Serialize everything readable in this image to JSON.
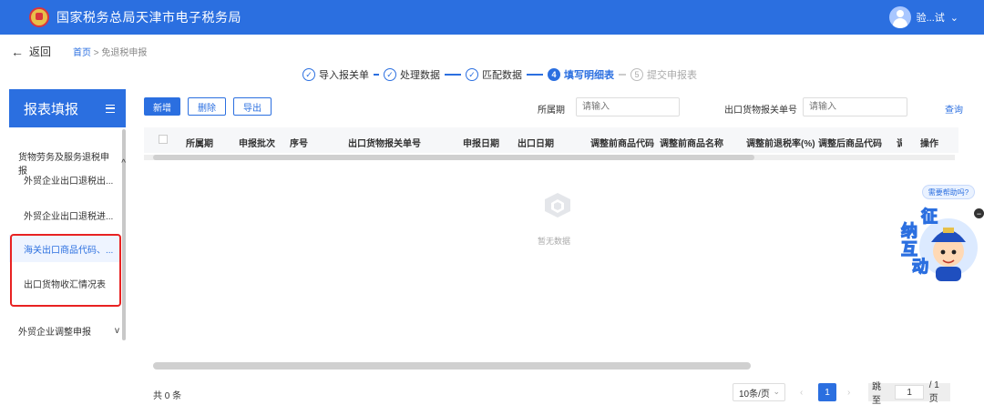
{
  "header": {
    "title": "国家税务总局天津市电子税务局",
    "user_name": "验...试"
  },
  "nav": {
    "back_label": "返回",
    "breadcrumb_home": "首页",
    "breadcrumb_sep": ">",
    "breadcrumb_current": "免退税申报"
  },
  "steps": [
    {
      "label": "导入报关单",
      "marker": "✓"
    },
    {
      "label": "处理数据",
      "marker": "✓"
    },
    {
      "label": "匹配数据",
      "marker": "✓"
    },
    {
      "label": "填写明细表",
      "marker": "4"
    },
    {
      "label": "提交申报表",
      "marker": "5"
    }
  ],
  "sidebar": {
    "title": "报表填报",
    "group1": "货物劳务及服务退税申报",
    "group1_arrow": "^",
    "items": [
      "外贸企业出口退税出...",
      "外贸企业出口退税进...",
      "海关出口商品代码、...",
      "出口货物收汇情况表"
    ],
    "group2": "外贸企业调整申报",
    "group2_arrow": "v"
  },
  "toolbar": {
    "add": "新增",
    "delete": "删除",
    "export": "导出"
  },
  "filters": {
    "period_label": "所属期",
    "period_placeholder": "请输入",
    "customs_label": "出口货物报关单号",
    "customs_placeholder": "请输入",
    "query": "查询"
  },
  "table": {
    "columns": [
      "所属期",
      "申报批次",
      "序号",
      "出口货物报关单号",
      "申报日期",
      "出口日期",
      "调整前商品代码",
      "调整前商品名称",
      "调整前退税率(%)",
      "调整后商品代码",
      "调",
      "操作"
    ],
    "empty_text": "暂无数据"
  },
  "pagination": {
    "total": "共 0 条",
    "page_size": "10条/页",
    "current_page": "1",
    "jump_label": "跳至",
    "jump_value": "1",
    "page_total": "/ 1 页"
  },
  "float": {
    "help_text": "需要帮助吗?",
    "mascot_chars": [
      "征",
      "纳",
      "互",
      "动"
    ]
  },
  "colors": {
    "primary": "#2b6fe0",
    "highlight_border": "#e82222"
  }
}
